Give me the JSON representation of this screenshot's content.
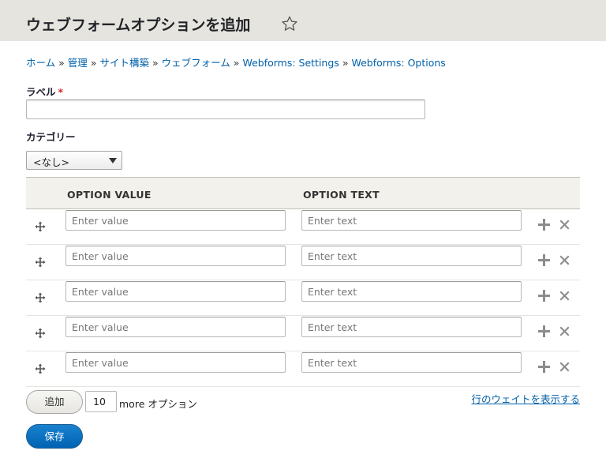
{
  "page": {
    "title": "ウェブフォームオプションを追加"
  },
  "breadcrumb": [
    {
      "label": "ホーム"
    },
    {
      "label": "管理"
    },
    {
      "label": "サイト構築"
    },
    {
      "label": "ウェブフォーム"
    },
    {
      "label": "Webforms: Settings"
    },
    {
      "label": "Webforms: Options"
    }
  ],
  "breadcrumb_separator": "»",
  "form": {
    "label_field": {
      "label": "ラベル",
      "required_mark": "*",
      "value": ""
    },
    "category_field": {
      "label": "カテゴリー",
      "selected": "<なし>"
    }
  },
  "table": {
    "col_value": "OPTION VALUE",
    "col_text": "OPTION TEXT",
    "rows": [
      {
        "value_placeholder": "Enter value",
        "text_placeholder": "Enter text"
      },
      {
        "value_placeholder": "Enter value",
        "text_placeholder": "Enter text"
      },
      {
        "value_placeholder": "Enter value",
        "text_placeholder": "Enter text"
      },
      {
        "value_placeholder": "Enter value",
        "text_placeholder": "Enter text"
      },
      {
        "value_placeholder": "Enter value",
        "text_placeholder": "Enter text"
      }
    ]
  },
  "actions": {
    "add_label": "追加",
    "more_count": "10",
    "more_text": "more オプション",
    "show_weights_label": "行のウェイトを表示する",
    "save_label": "保存"
  },
  "icons": {
    "favorite": "star-outline-icon",
    "drag": "drag-handle-icon",
    "add": "plus-icon",
    "remove": "close-icon"
  },
  "colors": {
    "link": "#0060aa",
    "primary_button": "#0063b3",
    "header_bg": "#e5e4de",
    "required": "#dc2323"
  }
}
